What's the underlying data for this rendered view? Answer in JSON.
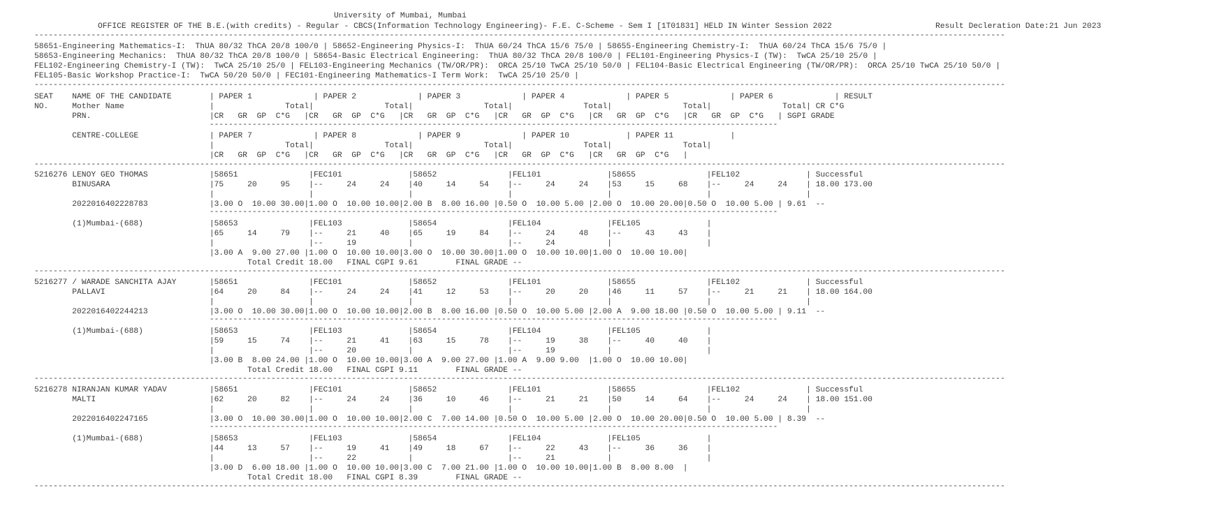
{
  "header": {
    "university": "University of Mumbai, Mumbai",
    "register_title": "OFFICE REGISTER OF THE B.E.(with credits) - Regular - CBCS(Information Technology Engineering)- F.E. C-Scheme - Sem I [1T01831] HELD IN Winter Session 2022",
    "declaration": "Result Decleration Date:21 Jun 2023"
  },
  "subjects_legend": [
    "58651-Engineering Mathematics-I:  ThUA 80/32 ThCA 20/8 100/0 | 58652-Engineering Physics-I:  ThUA 60/24 ThCA 15/6 75/0 | 58655-Engineering Chemistry-I:  ThUA 60/24 ThCA 15/6 75/0 |",
    "58653-Engineering Mechanics:  ThUA 80/32 ThCA 20/8 100/0 | 58654-Basic Electrical Engineering:  ThUA 80/32 ThCA 20/8 100/0 | FEL101-Engineering Physics-I (TW):  TwCA 25/10 25/0 |",
    "FEL102-Engineering Chemistry-I (TW):  TwCA 25/10 25/0 | FEL103-Engineering Mechanics (TW/OR/PR):  ORCA 25/10 TwCA 25/10 50/0 | FEL104-Basic Electrical Engineering (TW/OR/PR):  ORCA 25/10 TwCA 25/10 50/0 |",
    "FEL105-Basic Workshop Practice-I:  TwCA 50/20 50/0 | FEC101-Engineering Mathematics-I Term Work:  TwCA 25/10 25/0 |"
  ],
  "column_header": [
    "SEAT    NAME OF THE CANDIDATE        | PAPER 1             | PAPER 2             | PAPER 3             | PAPER 4             | PAPER 5             | PAPER 6             | RESULT",
    "NO.     Mother Name                  |               Total|               Total|               Total|               Total|               Total|               Total| CR C*G",
    "        PRN.                         |CR   GR  GP  C*G   |CR   GR  GP  C*G   |CR   GR  GP  C*G   |CR   GR  GP  C*G   |CR   GR  GP  C*G   |CR   GR  GP  C*G   | SGPI GRADE",
    "                                     ------------------------------------------------------------------------------------------------------------------------",
    "        CENTRE-COLLEGE               | PAPER 7             | PAPER 8             | PAPER 9             | PAPER 10            | PAPER 11            |",
    "                                     |               Total|               Total|               Total|               Total|               Total|",
    "                                     |CR   GR  GP  C*G   |CR   GR  GP  C*G   |CR   GR  GP  C*G   |CR   GR  GP  C*G   |CR   GR  GP  C*G   |"
  ],
  "candidates": [
    {
      "lines": [
        "5216276 LENOY GEO THOMAS             |58651               |FEC101              |58652               |FEL101              |58655               |FEL102              | Successful",
        "        BINUSARA                     |75     20     95    |--     24     24    |40     14     54    |--     24     24    |53     15     68    |--     24     24    | 18.00 173.00",
        "                                     |                    |                    |                    |                    |                    |                    |",
        "        2022016402228783             |3.00 O  10.00 30.00|1.00 O  10.00 10.00|2.00 B  8.00 16.00 |0.50 O  10.00 5.00 |2.00 O  10.00 20.00|0.50 O  10.00 5.00 | 9.61  --",
        "                                     ------------------------------------------------------------------------------------------------------------------------",
        "        (1)Mumbai-(688)              |58653               |FEL103              |58654               |FEL104              |FEL105              |",
        "                                     |65     14     79    |--     21     40    |65     19     84    |--     24     48    |--     43     43    |",
        "                                     |                    |--     19           |                    |--     24           |                    |",
        "                                     |3.00 A  9.00 27.00 |1.00 O  10.00 10.00|3.00 O  10.00 30.00|1.00 O  10.00 10.00|1.00 O  10.00 10.00|",
        "                                             Total Credit 18.00   FINAL CGPI 9.61        FINAL GRADE --"
      ]
    },
    {
      "lines": [
        "5216277 / WARADE SANCHITA AJAY       |58651               |FEC101              |58652               |FEL101              |58655               |FEL102              | Successful",
        "        PALLAVI                      |64     20     84    |--     24     24    |41     12     53    |--     20     20    |46     11     57    |--     21     21    | 18.00 164.00",
        "                                     |                    |                    |                    |                    |                    |                    |",
        "        2022016402244213             |3.00 O  10.00 30.00|1.00 O  10.00 10.00|2.00 B  8.00 16.00 |0.50 O  10.00 5.00 |2.00 A  9.00 18.00 |0.50 O  10.00 5.00 | 9.11  --",
        "                                     ------------------------------------------------------------------------------------------------------------------------",
        "        (1)Mumbai-(688)              |58653               |FEL103              |58654               |FEL104              |FEL105              |",
        "                                     |59     15     74    |--     21     41    |63     15     78    |--     19     38    |--     40     40    |",
        "                                     |                    |--     20           |                    |--     19           |                    |",
        "                                     |3.00 B  8.00 24.00 |1.00 O  10.00 10.00|3.00 A  9.00 27.00 |1.00 A  9.00 9.00  |1.00 O  10.00 10.00|",
        "                                             Total Credit 18.00   FINAL CGPI 9.11        FINAL GRADE --"
      ]
    },
    {
      "lines": [
        "5216278 NIRANJAN KUMAR YADAV         |58651               |FEC101              |58652               |FEL101              |58655               |FEL102              | Successful",
        "        MALTI                        |62     20     82    |--     24     24    |36     10     46    |--     21     21    |50     14     64    |--     24     24    | 18.00 151.00",
        "                                     |                    |                    |                    |                    |                    |                    |",
        "        2022016402247165             |3.00 O  10.00 30.00|1.00 O  10.00 10.00|2.00 C  7.00 14.00 |0.50 O  10.00 5.00 |2.00 O  10.00 20.00|0.50 O  10.00 5.00 | 8.39  --",
        "                                     ------------------------------------------------------------------------------------------------------------------------",
        "        (1)Mumbai-(688)              |58653               |FEL103              |58654               |FEL104              |FEL105              |",
        "                                     |44     13     57    |--     19     41    |49     18     67    |--     22     43    |--     36     36    |",
        "                                     |                    |--     22           |                    |--     21           |                    |",
        "                                     |3.00 D  6.00 18.00 |1.00 O  10.00 10.00|3.00 C  7.00 21.00 |1.00 O  10.00 10.00|1.00 B  8.00 8.00  |",
        "                                             Total Credit 18.00   FINAL CGPI 8.39        FINAL GRADE --"
      ]
    }
  ]
}
